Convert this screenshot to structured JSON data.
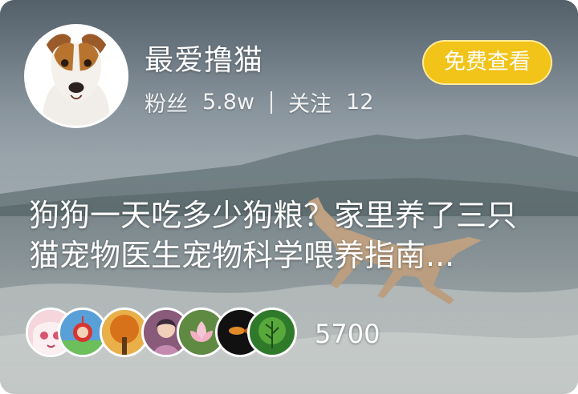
{
  "author": {
    "name": "最爱撸猫",
    "avatar_icon": "dog-avatar-icon",
    "followers_label": "粉丝",
    "followers_value": "5.8w",
    "following_label": "关注",
    "following_value": "12"
  },
  "action": {
    "free_view_label": "免费查看",
    "color": "#f2c318"
  },
  "post": {
    "title": "狗狗一天吃多少狗粮？家里养了三只猫宠物医生宠物科学喂养指南..."
  },
  "viewers": {
    "avatars": [
      {
        "icon": "anime-girl-avatar-icon",
        "color": "#f4d6dc"
      },
      {
        "icon": "teletubby-avatar-icon",
        "color": "#5aa0d8"
      },
      {
        "icon": "autumn-tree-avatar-icon",
        "color": "#d88a1c"
      },
      {
        "icon": "painted-figure-avatar-icon",
        "color": "#8a5a7a"
      },
      {
        "icon": "lotus-avatar-icon",
        "color": "#5f8a42"
      },
      {
        "icon": "goldfish-avatar-icon",
        "color": "#1a1a1a"
      },
      {
        "icon": "green-tree-avatar-icon",
        "color": "#2f7a2a"
      }
    ],
    "count": "5700"
  }
}
